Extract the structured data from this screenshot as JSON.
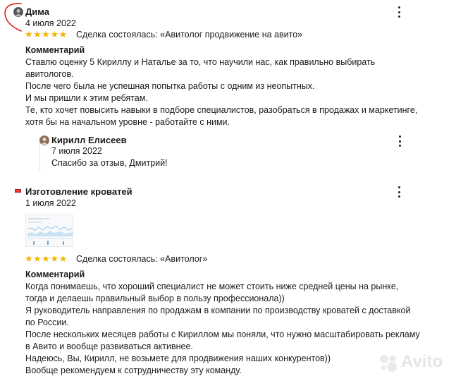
{
  "review1": {
    "author": "Дима",
    "date": "4 июля 2022",
    "stars": "★★★★★",
    "deal": "Сделка состоялась: «Авитолог продвижение на авито»",
    "comment_heading": "Комментарий",
    "comment_lines": [
      "Ставлю оценку 5 Кириллу и Наталье за то, что научили нас, как правильно выбирать",
      "авитологов.",
      "После чего была не успешная попытка работы с одним из неопытных.",
      "И мы пришли к этим ребятам.",
      "Те, кто хочет повысить навыки в подборе специалистов, разобраться в продажах и маркетинге,",
      "хотя бы на начальном уровне - работайте с ними."
    ],
    "reply": {
      "author": "Кирилл Елисеев",
      "date": "7 июля 2022",
      "text": "Спасибо за отзыв, Дмитрий!"
    }
  },
  "review2": {
    "author": "Изготовление кроватей",
    "date": "1 июля 2022",
    "stars": "★★★★★",
    "deal": "Сделка состоялась: «Авитолог»",
    "comment_heading": "Комментарий",
    "comment_lines": [
      "Когда понимаешь, что хороший специалист не может стоить ниже средней цены на рынке,",
      "тогда и делаешь правильный выбор в пользу профессионала))",
      "Я руководитель направления по продажам в компании по производству кроватей с доставкой",
      "по России.",
      "После нескольких месяцев работы с Кириллом мы поняли, что нужно масштабировать рекламу",
      "в Авито и вообще развиваться активнее.",
      "Надеюсь, Вы, Кирилл, не возьмете для продвижения наших конкурентов))",
      "Вообще рекомендуем к сотрудничеству эту команду."
    ]
  },
  "watermark": "Avito",
  "colors": {
    "star": "#f5b400",
    "annotation": "#e0201a",
    "text": "#1a1a1a"
  },
  "icons": [
    "avatar",
    "more-vertical-icon",
    "red-flag-icon",
    "avito-logo"
  ]
}
